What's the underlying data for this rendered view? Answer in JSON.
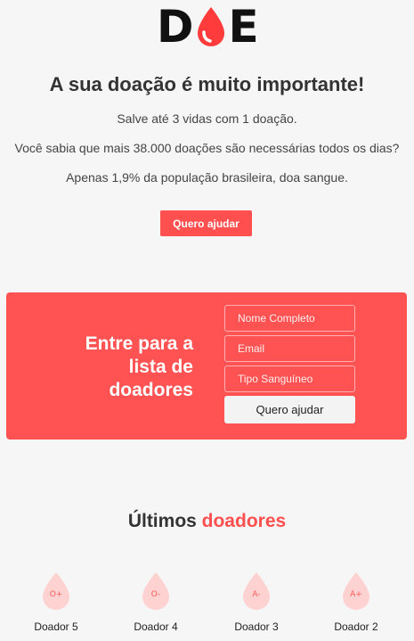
{
  "logo": {
    "letters": [
      "D",
      "E"
    ],
    "drop_color": "#ff3b3b",
    "icon": "blood-drop-icon"
  },
  "hero": {
    "title": "A sua doação é muito importante!",
    "lines": [
      "Salve até 3 vidas com 1 doação.",
      "Você sabia que mais 38.000 doações são necessárias todos os dias?",
      "Apenas 1,9% da população brasileira, doa sangue."
    ],
    "button_label": "Quero ajudar"
  },
  "signup": {
    "title": "Entre para a lista de doadores",
    "fields": {
      "name_placeholder": "Nome Completo",
      "email_placeholder": "Email",
      "blood_type_placeholder": "Tipo Sanguíneo"
    },
    "button_label": "Quero ajudar",
    "background_color": "#ff5252"
  },
  "donors": {
    "title_prefix": "Últimos ",
    "title_accent": "doadores",
    "accent_color": "#ff4f4f",
    "items": [
      {
        "blood_type": "O+",
        "name": "Doador 5"
      },
      {
        "blood_type": "O-",
        "name": "Doador 4"
      },
      {
        "blood_type": "A-",
        "name": "Doador 3"
      },
      {
        "blood_type": "A+",
        "name": "Doador 2"
      }
    ]
  }
}
